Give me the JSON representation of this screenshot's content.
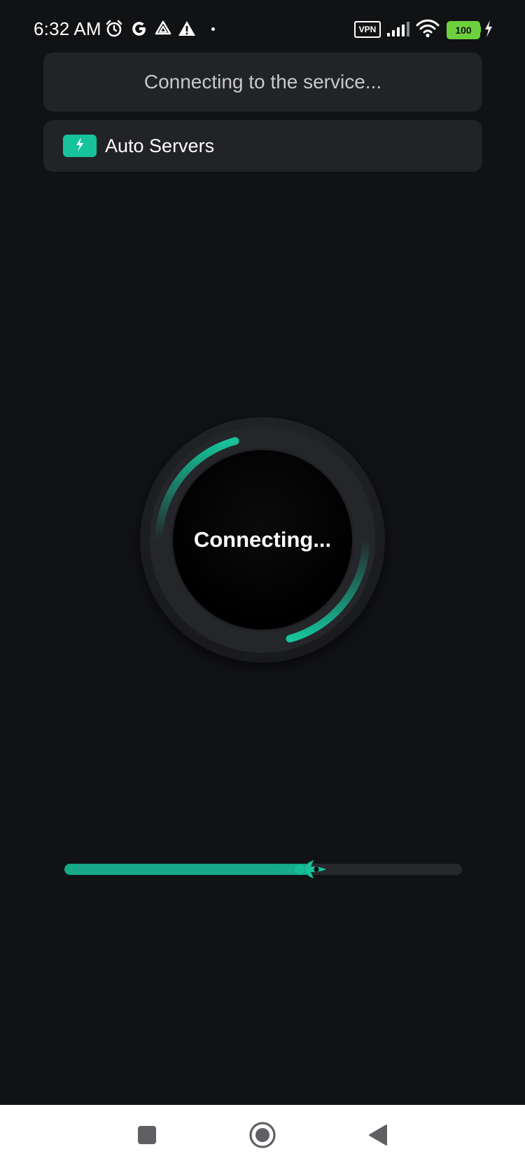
{
  "status_bar": {
    "time": "6:32 AM",
    "vpn_label": "VPN",
    "battery": "100"
  },
  "header": {
    "status_text": "Connecting to the service..."
  },
  "server": {
    "label": "Auto Servers"
  },
  "dial": {
    "label": "Connecting...",
    "accent": "#17c39b"
  },
  "progress": {
    "value": 0.62,
    "accent": "#16a887"
  },
  "icons": {
    "alarm": "alarm-icon",
    "google": "google-icon",
    "drive": "drive-icon",
    "warning": "warning-icon",
    "signal": "signal-icon",
    "wifi": "wifi-icon",
    "charging": "charging-icon",
    "server_badge": "lightning-icon",
    "rocket": "rocket-icon",
    "nav_recents": "recents-square-icon",
    "nav_home": "home-circle-icon",
    "nav_back": "back-triangle-icon"
  }
}
